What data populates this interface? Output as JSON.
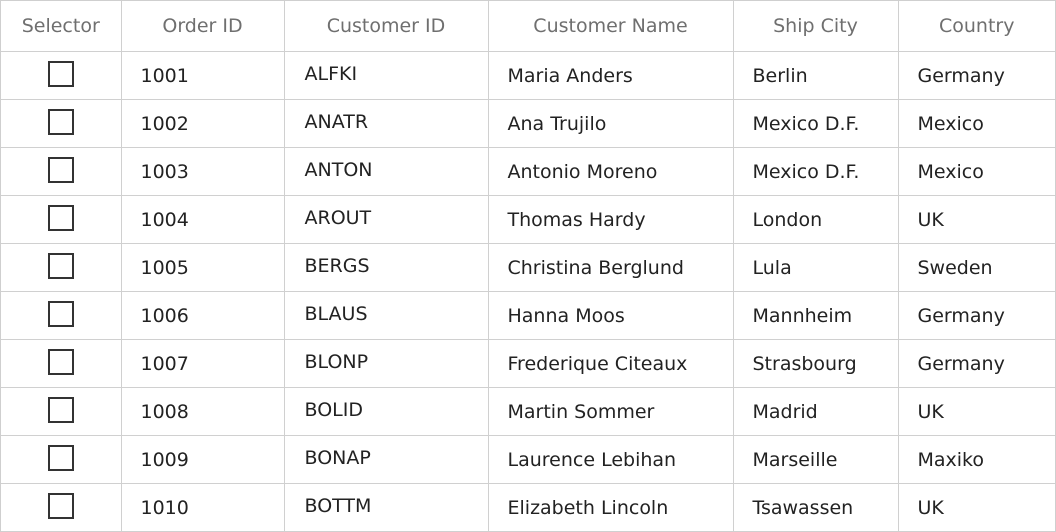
{
  "grid": {
    "columns": [
      "Selector",
      "Order ID",
      "Customer ID",
      "Customer Name",
      "Ship City",
      "Country"
    ],
    "rows": [
      {
        "checked": false,
        "order_id": "1001",
        "customer_id": "ALFKI",
        "customer_name": "Maria Anders",
        "ship_city": "Berlin",
        "country": "Germany"
      },
      {
        "checked": false,
        "order_id": "1002",
        "customer_id": "ANATR",
        "customer_name": "Ana Trujilo",
        "ship_city": "Mexico D.F.",
        "country": "Mexico"
      },
      {
        "checked": false,
        "order_id": "1003",
        "customer_id": "ANTON",
        "customer_name": "Antonio Moreno",
        "ship_city": "Mexico D.F.",
        "country": "Mexico"
      },
      {
        "checked": false,
        "order_id": "1004",
        "customer_id": "AROUT",
        "customer_name": "Thomas Hardy",
        "ship_city": "London",
        "country": "UK"
      },
      {
        "checked": false,
        "order_id": "1005",
        "customer_id": "BERGS",
        "customer_name": "Christina Berglund",
        "ship_city": "Lula",
        "country": "Sweden"
      },
      {
        "checked": false,
        "order_id": "1006",
        "customer_id": "BLAUS",
        "customer_name": "Hanna Moos",
        "ship_city": "Mannheim",
        "country": "Germany"
      },
      {
        "checked": false,
        "order_id": "1007",
        "customer_id": "BLONP",
        "customer_name": "Frederique Citeaux",
        "ship_city": "Strasbourg",
        "country": "Germany"
      },
      {
        "checked": false,
        "order_id": "1008",
        "customer_id": "BOLID",
        "customer_name": "Martin Sommer",
        "ship_city": "Madrid",
        "country": "UK"
      },
      {
        "checked": false,
        "order_id": "1009",
        "customer_id": "BONAP",
        "customer_name": "Laurence Lebihan",
        "ship_city": "Marseille",
        "country": "Maxiko"
      },
      {
        "checked": false,
        "order_id": "1010",
        "customer_id": "BOTTM",
        "customer_name": "Elizabeth Lincoln",
        "ship_city": "Tsawassen",
        "country": "UK"
      }
    ]
  },
  "colors": {
    "header_text": "#6f6f6f",
    "cell_text": "#222222",
    "grid_line": "#d0d0d0",
    "checkbox_border": "#333333"
  }
}
